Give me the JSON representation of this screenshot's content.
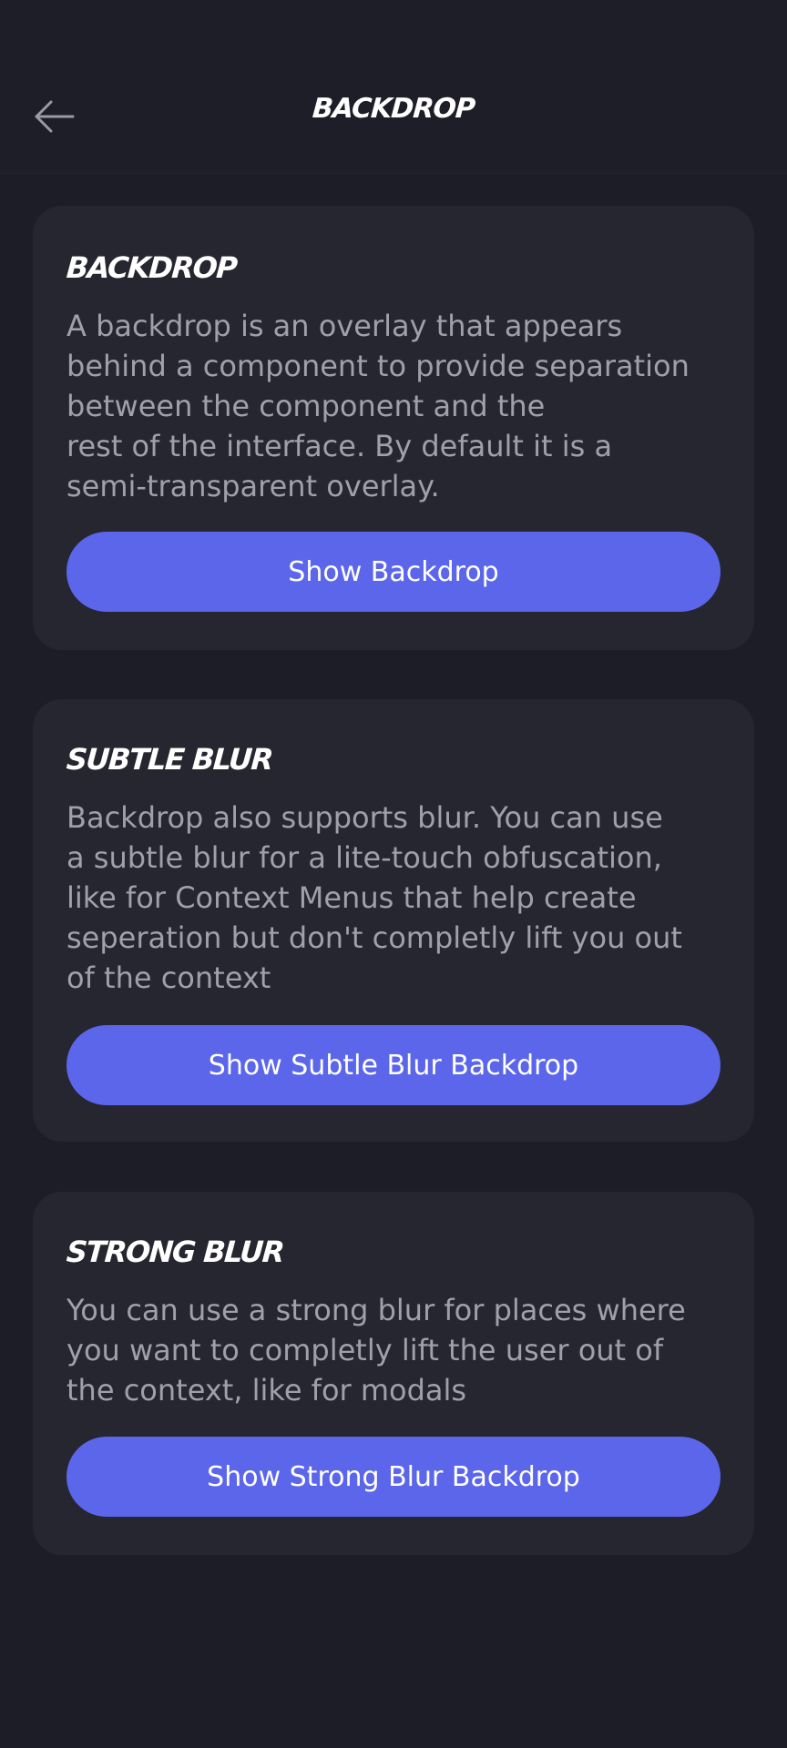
{
  "header": {
    "title": "BACKDROP",
    "back_icon": "arrow-left-icon"
  },
  "cards": [
    {
      "title": "BACKDROP",
      "description": "A backdrop is an overlay that appears\nbehind a component to provide separation\nbetween the component and the\nrest of the interface. By default it is a\nsemi-transparent overlay.",
      "button_label": "Show Backdrop"
    },
    {
      "title": "SUBTLE BLUR",
      "description": "Backdrop also supports blur. You can use\na subtle blur for a lite-touch obfuscation,\nlike for Context Menus that help create\nseperation but don't completly lift you out\nof the context",
      "button_label": "Show Subtle Blur Backdrop"
    },
    {
      "title": "STRONG BLUR",
      "description": "You can use a strong blur for places where\nyou want to completly lift the user out of\nthe context, like for modals",
      "button_label": "Show Strong Blur Backdrop"
    }
  ],
  "colors": {
    "background": "#1d1d27",
    "card": "#262631",
    "accent": "#5c66ea",
    "text_primary": "#ffffff",
    "text_secondary": "#a0a0ab"
  }
}
